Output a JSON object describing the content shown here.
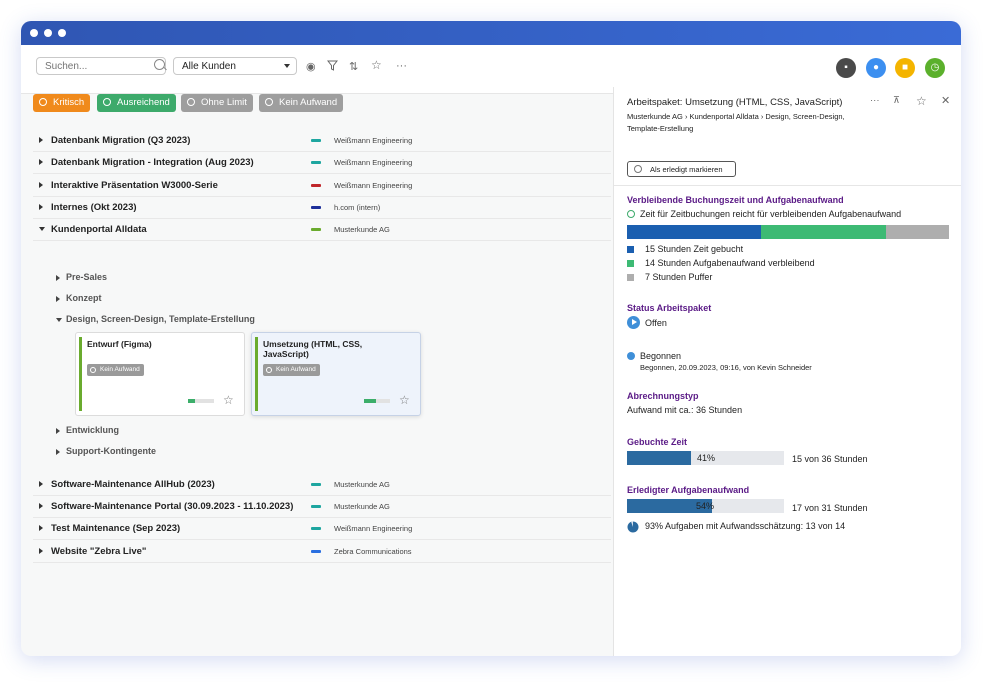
{
  "toolbar": {
    "search_placeholder": "Suchen...",
    "customer_select": "Alle Kunden",
    "more": "···",
    "circle_icons": [
      {
        "name": "folder-icon",
        "color": "#4a4a4a",
        "glyph": "▪"
      },
      {
        "name": "bell-icon",
        "color": "#3c8ff0",
        "glyph": "●"
      },
      {
        "name": "note-icon",
        "color": "#f4b400",
        "glyph": "■"
      },
      {
        "name": "clock-icon",
        "color": "#5bb02c",
        "glyph": "◷"
      }
    ]
  },
  "filters": [
    {
      "label": "Kritisch",
      "color": "#f08a1c"
    },
    {
      "label": "Ausreichend",
      "color": "#3daa6b"
    },
    {
      "label": "Ohne Limit",
      "color": "#9e9e9e"
    },
    {
      "label": "Kein Aufwand",
      "color": "#9e9e9e"
    }
  ],
  "projects_top": [
    {
      "label": "Datenbank Migration (Q3 2023)",
      "client": "Weißmann Engineering",
      "color": "#1ea6a0"
    },
    {
      "label": "Datenbank Migration - Integration (Aug 2023)",
      "client": "Weißmann Engineering",
      "color": "#1ea6a0"
    },
    {
      "label": "Interaktive Präsentation W3000-Serie",
      "client": "Weißmann Engineering",
      "color": "#c0262a"
    },
    {
      "label": "Internes (Okt 2023)",
      "client": "h.com (intern)",
      "color": "#1d2f9a"
    },
    {
      "label": "Kundenportal Alldata",
      "client": "Musterkunde AG",
      "color": "#6aab2e"
    }
  ],
  "subgroups": [
    "Pre-Sales",
    "Konzept",
    "Design, Screen-Design, Template-Erstellung",
    "Entwicklung",
    "Support-Kontingente"
  ],
  "cards": [
    {
      "title": "Entwurf (Figma)",
      "tag": "Kein Aufwand",
      "progress": 0.25
    },
    {
      "title": "Umsetzung (HTML, CSS, JavaScript)",
      "tag": "Kein Aufwand",
      "progress": 0.45
    }
  ],
  "projects_bottom": [
    {
      "label": "Software-Maintenance AllHub (2023)",
      "client": "Musterkunde AG",
      "color": "#1ea6a0"
    },
    {
      "label": "Software-Maintenance Portal (30.09.2023 - 11.10.2023)",
      "client": "Musterkunde AG",
      "color": "#1ea6a0"
    },
    {
      "label": "Test Maintenance (Sep 2023)",
      "client": "Weißmann Engineering",
      "color": "#1ea6a0"
    },
    {
      "label": "Website \"Zebra Live\"",
      "client": "Zebra Communications",
      "color": "#2a6fe0"
    }
  ],
  "panel": {
    "title": "Arbeitspaket: Umsetzung (HTML, CSS, JavaScript)",
    "breadcrumb": "Musterkunde AG › Kundenportal Alldata › Design, Screen-Design, Template-Erstellung",
    "mark_done": "Als erledigt markieren",
    "remaining_heading": "Verbleibende Buchungszeit und Aufgabenaufwand",
    "remaining_status": "Zeit für Zeitbuchungen reicht für verbleibenden Aufgabenaufwand",
    "stack": [
      {
        "label": "15 Stunden Zeit gebucht",
        "hours": 15,
        "color": "#1b5fb0"
      },
      {
        "label": "14 Stunden Aufgabenaufwand verbleibend",
        "hours": 14,
        "color": "#3dba74"
      },
      {
        "label": "7 Stunden Puffer",
        "hours": 7,
        "color": "#aeaeae"
      }
    ],
    "status_heading": "Status Arbeitspaket",
    "status_value": "Offen",
    "begun_label": "Begonnen",
    "begun_detail": "Begonnen, 20.09.2023, 09:16, von Kevin Schneider",
    "billing_heading": "Abrechnungstyp",
    "billing_value": "Aufwand mit ca.: 36 Stunden",
    "booked_heading": "Gebuchte Zeit",
    "booked_pct_label": "41%",
    "booked_pct": 0.41,
    "booked_text": "15 von 36 Stunden",
    "done_heading": "Erledigter Aufgabenaufwand",
    "done_pct_label": "54%",
    "done_pct": 0.54,
    "done_text": "17 von 31 Stunden",
    "estimate_text": "93% Aufgaben mit Aufwandsschätzung: 13 von 14"
  }
}
